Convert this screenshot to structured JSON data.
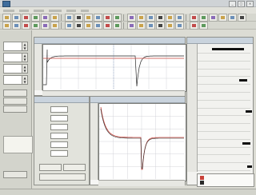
{
  "window": {
    "title": "",
    "accent": "#3f6d9c"
  },
  "menu": {
    "items": []
  },
  "toolbar": {
    "icon_colors": [
      "#c9a24b",
      "#6b8fb8",
      "#c24b4b",
      "#5d9a5d",
      "#8a6bb8",
      "#c9a24b",
      "#6b8fb8",
      "#444444"
    ]
  },
  "trace_colors": {
    "primary": "#c8423a",
    "secondary": "#2a2a2a",
    "grid": "#c9ccd0",
    "marker": "#6a86b8"
  },
  "panels": {
    "top_plot": {
      "name": "",
      "shape": "step-with-spikes"
    },
    "bottom_plot": {
      "name": "",
      "shape": "exponential-decay-with-spike"
    },
    "right_plot": {
      "name": ""
    }
  },
  "legend": {
    "entries": []
  }
}
